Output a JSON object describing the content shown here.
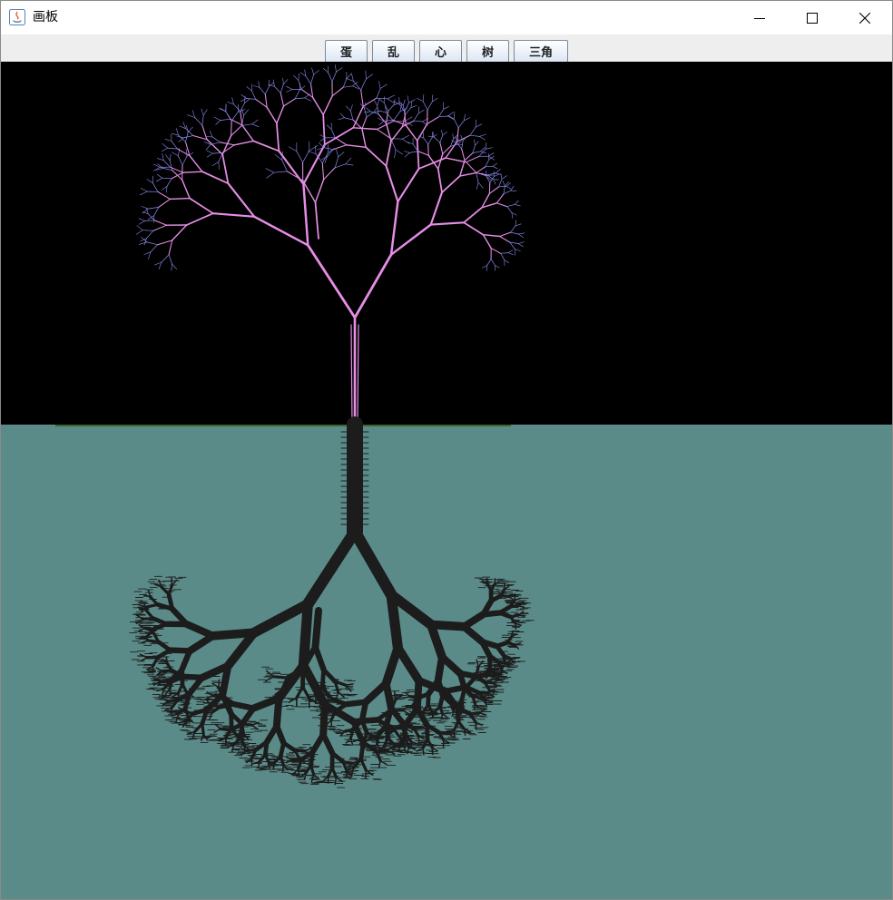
{
  "window": {
    "title": "画板",
    "controls": {
      "minimize": "minimize",
      "maximize": "maximize",
      "close": "close"
    }
  },
  "toolbar": {
    "buttons": [
      {
        "label": "蛋"
      },
      {
        "label": "乱"
      },
      {
        "label": "心"
      },
      {
        "label": "树"
      },
      {
        "label": "三角"
      }
    ]
  },
  "canvas": {
    "sky_color": "#000000",
    "water_color": "#5b8b88",
    "branch_color": "#e68ee6",
    "tip_color": "#8c8cf0",
    "reflection_color": "#1c1c1c",
    "ground_line_color": "#3c6428"
  }
}
